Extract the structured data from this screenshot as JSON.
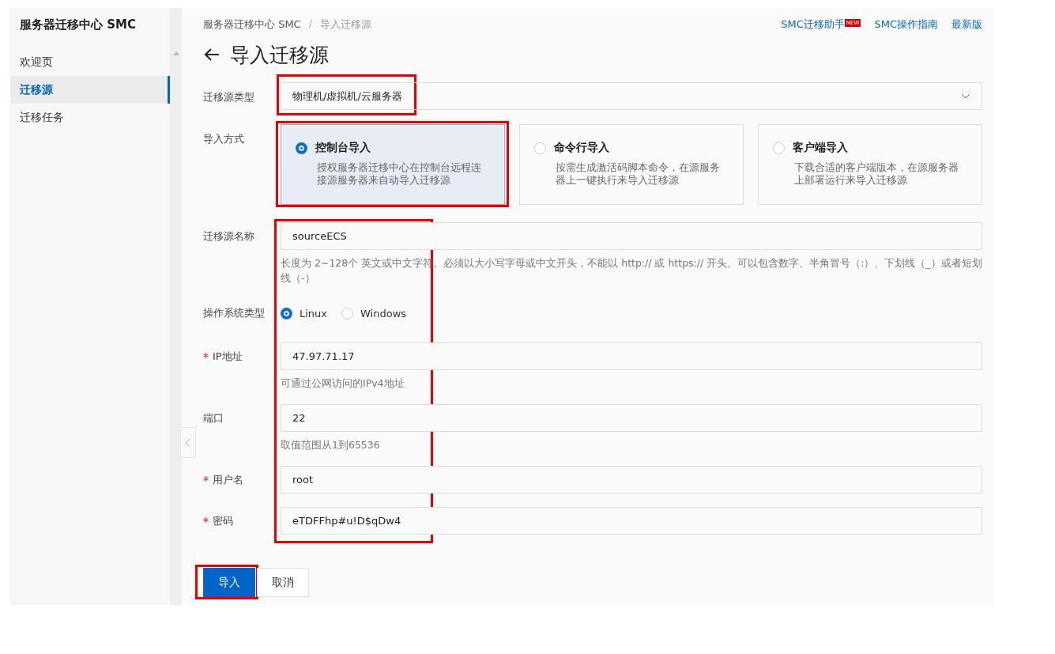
{
  "sidebar": {
    "title": "服务器迁移中心 SMC",
    "items": [
      {
        "label": "欢迎页",
        "selected": false
      },
      {
        "label": "迁移源",
        "selected": true
      },
      {
        "label": "迁移任务",
        "selected": false
      }
    ]
  },
  "breadcrumb": [
    "服务器迁移中心 SMC",
    "导入迁移源"
  ],
  "breadcrumb_separator": "/",
  "header_links": [
    {
      "label": "SMC迁移助手",
      "badge": "NEW"
    },
    {
      "label": "SMC操作指南"
    },
    {
      "label": "最新版"
    }
  ],
  "page_title": "导入迁移源",
  "form": {
    "source_type": {
      "label": "迁移源类型",
      "value": "物理机/虚拟机/云服务器"
    },
    "import_method": {
      "label": "导入方式",
      "options": [
        {
          "title": "控制台导入",
          "description": "授权服务器迁移中心在控制台远程连接源服务器来自动导入迁移源",
          "selected": true
        },
        {
          "title": "命令行导入",
          "description": "按需生成激活码脚本命令，在源服务器上一键执行来导入迁移源",
          "selected": false
        },
        {
          "title": "客户端导入",
          "description": "下载合适的客户端版本，在源服务器上部署运行来导入迁移源",
          "selected": false
        }
      ]
    },
    "source_name": {
      "label": "迁移源名称",
      "required": false,
      "value": "sourceECS",
      "hint": "长度为 2~128个 英文或中文字符。必须以大小写字母或中文开头，不能以 http:// 或 https:// 开头。可以包含数字、半角冒号（:）、下划线（_）或者短划线（-）"
    },
    "os_type": {
      "label": "操作系统类型",
      "options": [
        {
          "label": "Linux",
          "selected": true
        },
        {
          "label": "Windows",
          "selected": false
        }
      ]
    },
    "fields": [
      {
        "label": "IP地址",
        "required": true,
        "value": "47.97.71.17",
        "hint": "可通过公网访问的IPv4地址"
      },
      {
        "label": "端口",
        "required": false,
        "value": "22",
        "hint": "取值范围从1到65536"
      },
      {
        "label": "用户名",
        "required": true,
        "value": "root"
      },
      {
        "label": "密码",
        "required": true,
        "value": "eTDFFhp#u!D$qDw4"
      }
    ]
  },
  "buttons": [
    {
      "label": "导入",
      "kind": "primary"
    },
    {
      "label": "取消",
      "kind": "secondary"
    }
  ]
}
